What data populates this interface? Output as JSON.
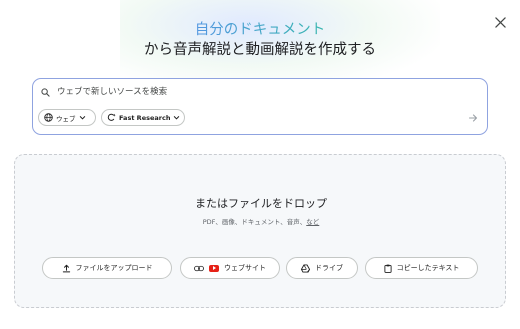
{
  "header": {
    "title_line1": "自分のドキュメント",
    "title_line2": "から音声解説と動画解説を作成する"
  },
  "search": {
    "placeholder": "ウェブで新しいソースを検索",
    "value": "",
    "source_chip": "ウェブ",
    "mode_chip": "Fast Research"
  },
  "drop_zone": {
    "title": "またはファイルをドロップ",
    "supported": "PDF、画像、ドキュメント、音声、",
    "more_link": "など"
  },
  "buttons": {
    "upload": "ファイルをアップロード",
    "website": "ウェブサイト",
    "drive": "ドライブ",
    "copied_text": "コピーしたテキスト"
  },
  "colors": {
    "accent_border": "#8fa3e0",
    "youtube_red": "#e62117",
    "title_gradient_start": "#5b8df0",
    "title_gradient_end": "#2fbf9f"
  },
  "icons": {
    "close": "close-icon",
    "search": "search-icon",
    "globe": "globe-icon",
    "research": "research-sparkle-icon",
    "send": "arrow-right-icon",
    "upload": "upload-icon",
    "link": "link-icon",
    "youtube": "youtube-icon",
    "drive": "drive-icon",
    "clipboard": "clipboard-icon"
  }
}
